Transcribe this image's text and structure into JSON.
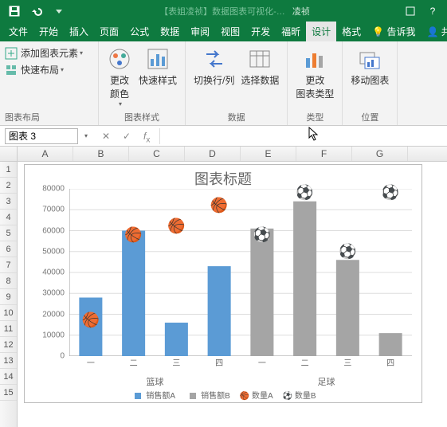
{
  "titlebar": {
    "doc": "【表姐凌祯】数据图表可视化-…",
    "user": "凌祯"
  },
  "tabs": [
    "文件",
    "开始",
    "插入",
    "页面",
    "公式",
    "数据",
    "审阅",
    "视图",
    "开发",
    "福昕",
    "设计",
    "格式"
  ],
  "active_tab": 10,
  "tell_me": "告诉我",
  "share": "共…",
  "ribbon": {
    "add_chart_element": "添加图表元素",
    "quick_layout": "快速布局",
    "g1": "图表布局",
    "change_colors": "更改\n颜色",
    "quick_styles": "快速样式",
    "g2": "图表样式",
    "switch_rc": "切换行/列",
    "select_data": "选择数据",
    "g3": "数据",
    "change_type": "更改\n图表类型",
    "g4": "类型",
    "move_chart": "移动图表",
    "g5": "位置"
  },
  "namebox": "图表 3",
  "cols": [
    "A",
    "B",
    "C",
    "D",
    "E",
    "F",
    "G"
  ],
  "rows": [
    "1",
    "2",
    "3",
    "4",
    "5",
    "6",
    "7",
    "8",
    "9",
    "10",
    "11",
    "12",
    "13",
    "14",
    "15"
  ],
  "chart_data": {
    "type": "bar",
    "title": "图表标题",
    "ylim": [
      0,
      80000
    ],
    "yticks": [
      0,
      10000,
      20000,
      30000,
      40000,
      50000,
      60000,
      70000,
      80000
    ],
    "groups": [
      "篮球",
      "足球"
    ],
    "categories": [
      "一",
      "二",
      "三",
      "四"
    ],
    "series": [
      {
        "name": "销售额A",
        "color": "#5b9bd5",
        "group": "篮球",
        "values": [
          28000,
          60000,
          16000,
          43000
        ]
      },
      {
        "name": "销售额B",
        "color": "#a5a5a5",
        "group": "足球",
        "values": [
          61000,
          74000,
          46000,
          11000
        ]
      },
      {
        "name": "数量A",
        "marker": "🏀",
        "group": "篮球",
        "values": [
          17000,
          58000,
          62000,
          72000
        ]
      },
      {
        "name": "数量B",
        "marker": "⚽",
        "group": "足球",
        "values": [
          58000,
          78000,
          50000,
          78000
        ]
      }
    ],
    "legend": [
      "销售额A",
      "销售额B",
      "数量A",
      "数量B"
    ]
  }
}
